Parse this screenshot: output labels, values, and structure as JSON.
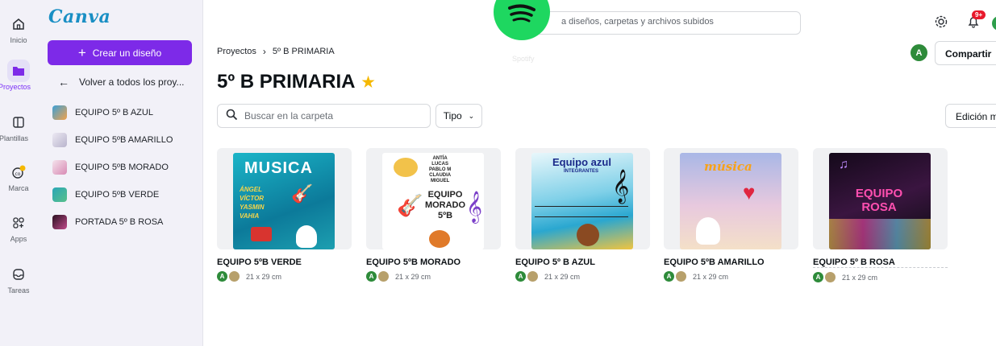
{
  "rail": {
    "items": [
      {
        "label": "Inicio",
        "icon": "home-icon"
      },
      {
        "label": "Proyectos",
        "icon": "folder-icon"
      },
      {
        "label": "Plantillas",
        "icon": "template-icon"
      },
      {
        "label": "Marca",
        "icon": "brand-icon"
      },
      {
        "label": "Apps",
        "icon": "apps-icon"
      },
      {
        "label": "Tareas",
        "icon": "tasks-icon"
      }
    ]
  },
  "panel": {
    "logo": "Canva",
    "create_label": "Crear un diseño",
    "back_label": "Volver a todos los proy...",
    "teams": [
      {
        "label": "EQUIPO 5º B AZUL",
        "color": "#3aa0d8"
      },
      {
        "label": "EQUIPO 5ºB AMARILLO",
        "color": "#d9d4e8"
      },
      {
        "label": "EQUIPO 5ºB MORADO",
        "color": "#e9c6d9"
      },
      {
        "label": "EQUIPO 5ºB VERDE",
        "color": "#33b0a0"
      },
      {
        "label": "PORTADA 5º B ROSA",
        "color": "#5a2a4a"
      }
    ]
  },
  "topbar": {
    "search_placeholder": "a diseños, carpetas y archivos subidos",
    "spotify_label": "Spotify",
    "notif_badge": "9+"
  },
  "header": {
    "breadcrumb_root": "Proyectos",
    "breadcrumb_current": "5º B PRIMARIA",
    "title": "5º B PRIMARIA",
    "avatar_letter": "A",
    "share_label": "Compartir",
    "folder_search_placeholder": "Buscar en la carpeta",
    "type_label": "Tipo",
    "edit_label": "Edición m"
  },
  "cards": [
    {
      "name": "EQUIPO 5ºB VERDE",
      "size": "21 x 29 cm",
      "art_title": "MUSICA",
      "art_lines": "ÁNGEL\nVÍCTOR\nYASMIN\nVAHIA"
    },
    {
      "name": "EQUIPO 5ºB MORADO",
      "size": "21 x 29 cm",
      "art_title": "EQUIPO MORADO 5ºB",
      "art_lines": "ANTÍA\nLUCAS\nPABLO M\nCLAUDIA\nMIGUEL"
    },
    {
      "name": "EQUIPO 5º B AZUL",
      "size": "21 x 29 cm",
      "art_title": "Equipo azul",
      "art_lines": "INTEGRANTES"
    },
    {
      "name": "EQUIPO 5ºB AMARILLO",
      "size": "21 x 29 cm",
      "art_title": "música",
      "art_lines": ""
    },
    {
      "name": "EQUIPO 5º B ROSA",
      "size": "21 x 29 cm",
      "art_title": "EQUIPO ROSA",
      "art_lines": ""
    }
  ],
  "avatar_letter_small": "A"
}
